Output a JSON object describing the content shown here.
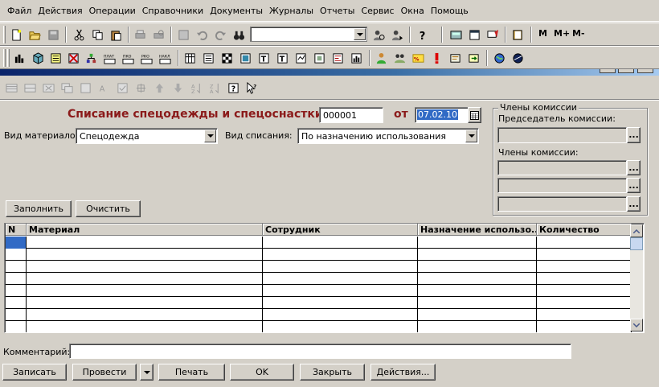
{
  "menu": [
    "Файл",
    "Действия",
    "Операции",
    "Справочники",
    "Документы",
    "Журналы",
    "Отчеты",
    "Сервис",
    "Окна",
    "Помощь"
  ],
  "toolbar": {
    "search_value": "",
    "memory_labels": [
      "M",
      "M+",
      "M-"
    ],
    "doc_icons": [
      "ПЛАТ",
      "ПКО",
      "РКО",
      "НАКЛ"
    ]
  },
  "form": {
    "title": "Списание спецодежды и спецоснастки №",
    "number": "000001",
    "from_label": "от",
    "date": "07.02.10",
    "materials_type_label": "Вид материалов:",
    "materials_type_value": "Спецодежда",
    "writeoff_type_label": "Вид списания:",
    "writeoff_type_value": "По назначению использования",
    "fill_button": "Заполнить",
    "clear_button": "Очистить",
    "comment_label": "Комментарий:",
    "comment_value": ""
  },
  "commission": {
    "legend": "Члены комиссии",
    "chairman_label": "Председатель комиссии:",
    "members_label": "Члены комиссии:",
    "chairman_value": "",
    "member_values": [
      "",
      "",
      ""
    ]
  },
  "table": {
    "columns": [
      "N",
      "Материал",
      "Сотрудник",
      "Назначение использо...",
      "Количество"
    ],
    "rows": [
      [
        "",
        "",
        "",
        "",
        ""
      ],
      [
        "",
        "",
        "",
        "",
        ""
      ],
      [
        "",
        "",
        "",
        "",
        ""
      ],
      [
        "",
        "",
        "",
        "",
        ""
      ],
      [
        "",
        "",
        "",
        "",
        ""
      ],
      [
        "",
        "",
        "",
        "",
        ""
      ],
      [
        "",
        "",
        "",
        "",
        ""
      ],
      [
        "",
        "",
        "",
        "",
        ""
      ]
    ]
  },
  "buttons": {
    "save": "Записать",
    "post": "Провести",
    "print": "Печать",
    "ok": "OK",
    "close": "Закрыть",
    "actions": "Действия..."
  },
  "colors": {
    "window_bg": "#d4d0c8",
    "title_red": "#8b1a1a",
    "selection_blue": "#316ac5"
  }
}
